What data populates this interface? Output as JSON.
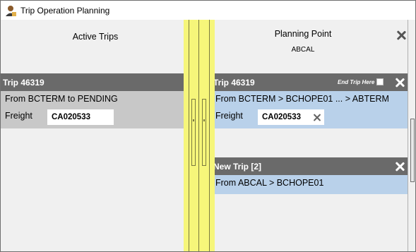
{
  "window": {
    "title": "Trip Operation Planning"
  },
  "active_trips": {
    "header": "Active Trips",
    "trip": {
      "title": "Trip 46319",
      "route": "From BCTERM to PENDING",
      "freight_label": "Freight",
      "freight_value": "CA020533"
    }
  },
  "planning_point": {
    "header": "Planning Point",
    "subheader": "ABCAL",
    "trip": {
      "title": "Trip 46319",
      "end_trip_label": "End Trip Here",
      "route": "From BCTERM > BCHOPE01 ... > ABTERM",
      "freight_label": "Freight",
      "freight_value": "CA020533"
    },
    "new_trip": {
      "title": "New Trip [2]",
      "route": "From ABCAL > BCHOPE01"
    }
  },
  "colors": {
    "header_grey": "#6a6a6a",
    "active_body": "#c8c8c8",
    "planning_body": "#b9d1ea",
    "splitter_yellow": "#f6f67a"
  }
}
